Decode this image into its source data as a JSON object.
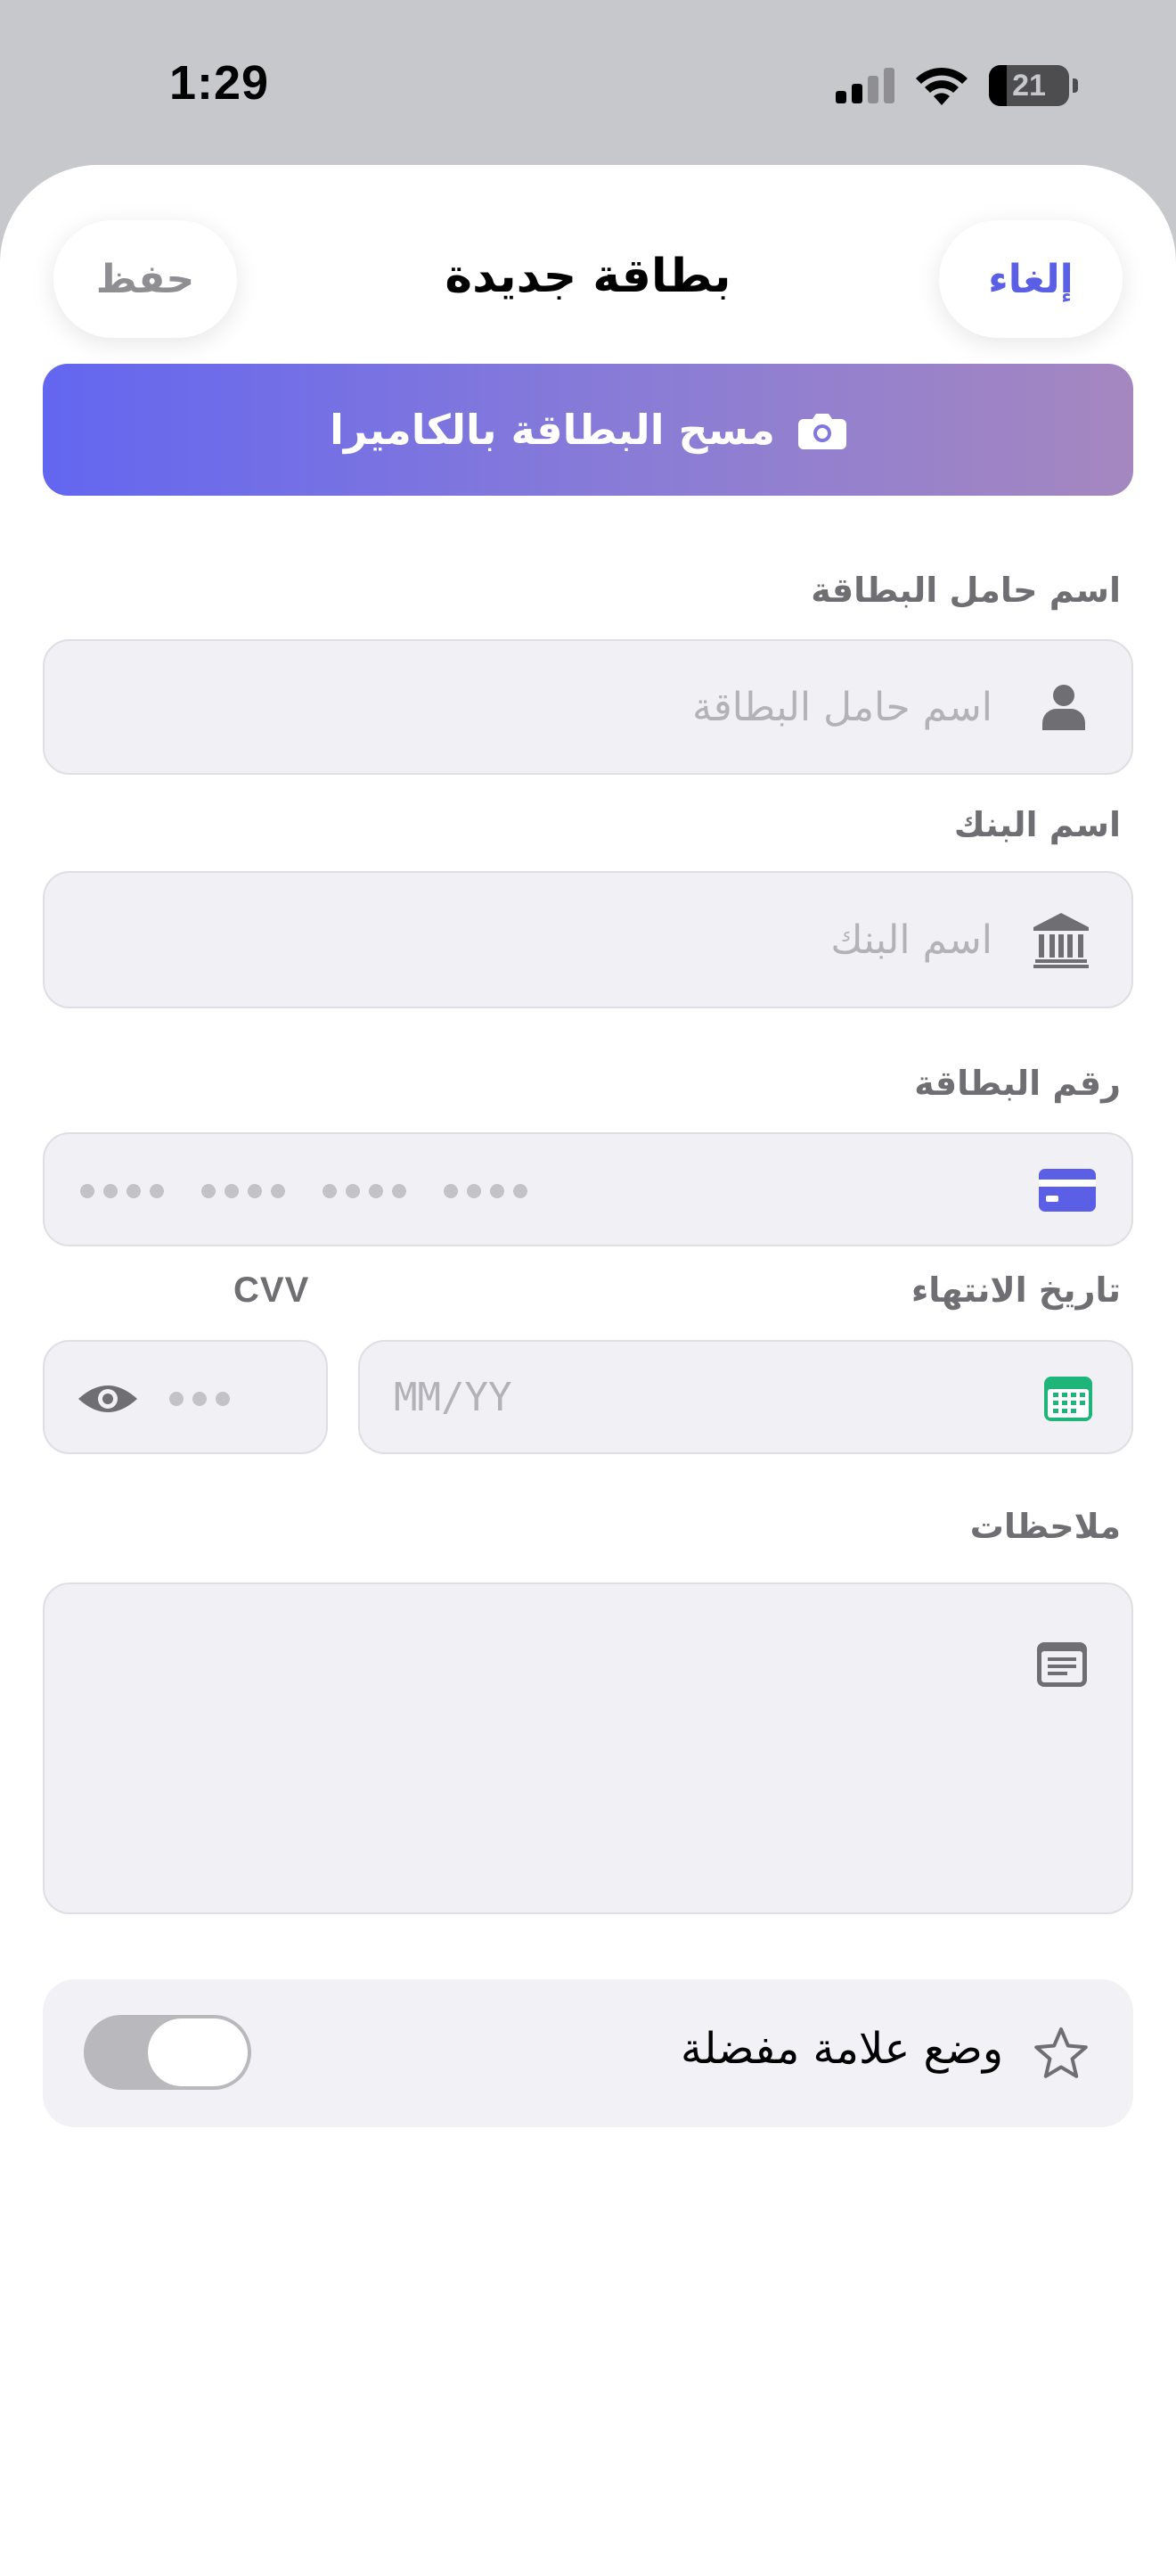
{
  "status_bar": {
    "time": "1:29",
    "battery_level": "21",
    "icons": [
      "cellular-signal-icon",
      "wifi-icon",
      "battery-icon"
    ]
  },
  "header": {
    "title": "بطاقة جديدة",
    "save_label": "حفظ",
    "cancel_label": "إلغاء"
  },
  "scan_button": {
    "label": "مسح البطاقة بالكاميرا",
    "icon": "camera-icon"
  },
  "form": {
    "holder": {
      "label": "اسم حامل البطاقة",
      "placeholder": "اسم حامل البطاقة",
      "icon": "person-icon"
    },
    "bank": {
      "label": "اسم البنك",
      "placeholder": "اسم البنك",
      "icon": "bank-icon"
    },
    "card_number": {
      "label": "رقم البطاقة",
      "icon": "credit-card-icon"
    },
    "expiry": {
      "label": "تاريخ الانتهاء",
      "placeholder": "MM/YY",
      "icon": "calendar-icon"
    },
    "cvv": {
      "label": "CVV",
      "icon": "eye-icon"
    },
    "notes": {
      "label": "ملاحظات",
      "icon": "notes-icon"
    }
  },
  "favorite": {
    "label": "وضع علامة مفضلة",
    "icon": "star-icon",
    "enabled": false
  },
  "colors": {
    "accent": "#5b5fe6",
    "gradient_start": "#6366f0",
    "gradient_end": "#a587c0",
    "calendar_green": "#1fb47a",
    "field_bg": "#f0f0f5"
  }
}
